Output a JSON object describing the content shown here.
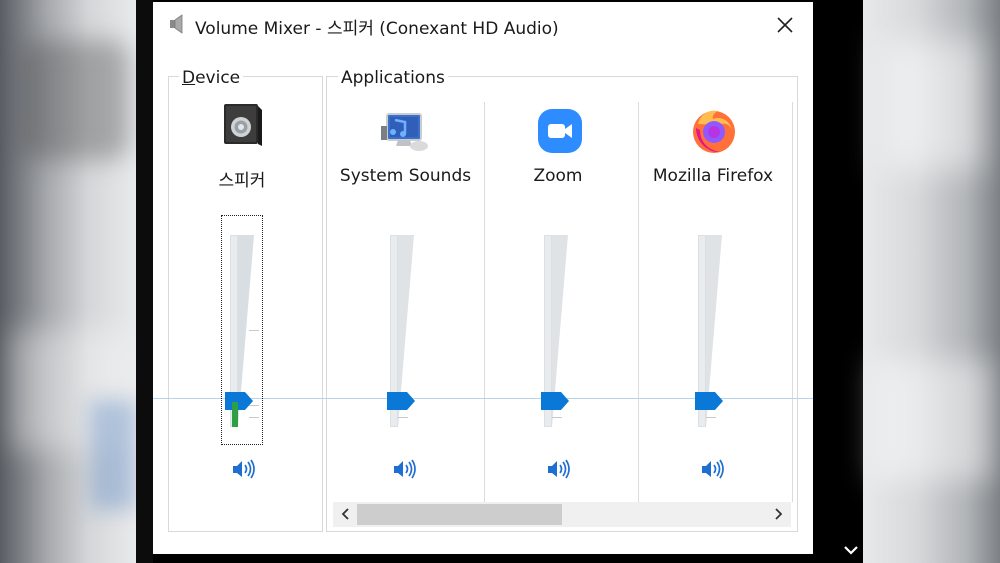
{
  "window": {
    "title": "Volume Mixer - 스피커 (Conexant HD Audio)"
  },
  "device_group": {
    "label_accel": "D",
    "label_rest": "evice",
    "device": {
      "name": "스피커",
      "icon": "speaker-device-icon",
      "volume_percent": 14,
      "peak_level_percent": 11
    }
  },
  "apps_group": {
    "label": "Applications",
    "apps": [
      {
        "name": "System Sounds",
        "icon": "system-sounds-icon",
        "volume_percent": 14
      },
      {
        "name": "Zoom",
        "icon": "zoom-icon",
        "volume_percent": 14
      },
      {
        "name": "Mozilla Firefox",
        "icon": "firefox-icon",
        "volume_percent": 14
      }
    ]
  },
  "colors": {
    "thumb": "#0a78d7",
    "level": "#2ea043",
    "track": "#e9ecee",
    "zoom_blue": "#2d8cff"
  },
  "scrollbar": {
    "position_percent": 0
  }
}
